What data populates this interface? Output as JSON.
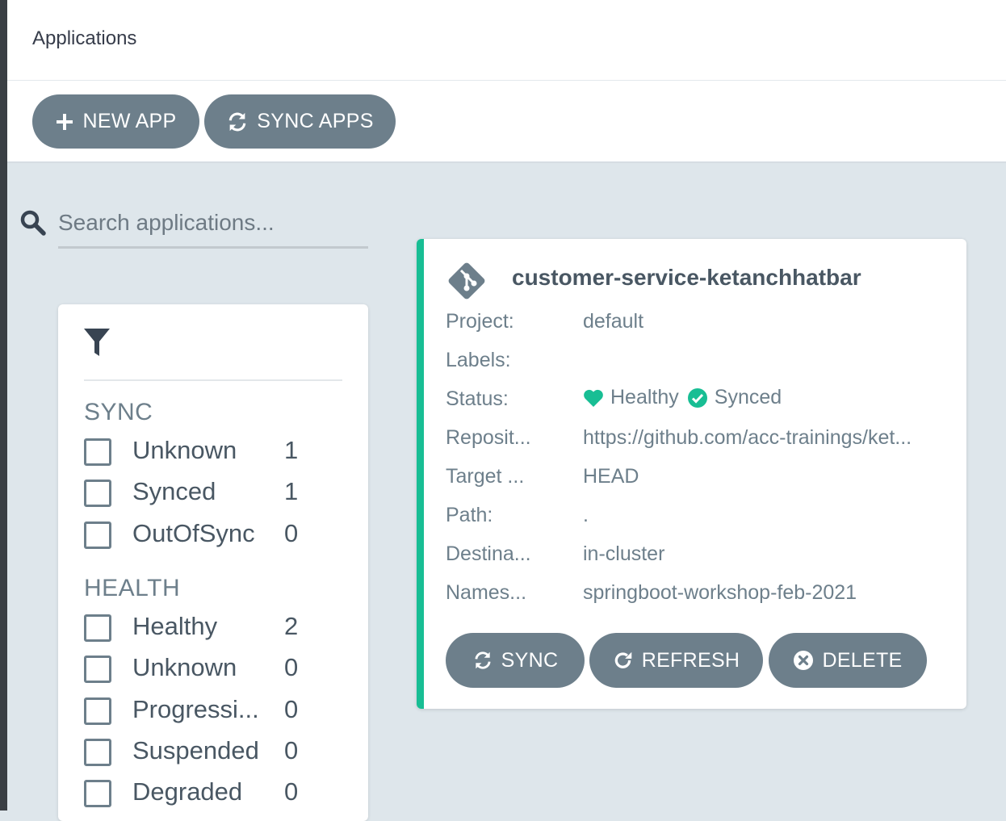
{
  "header": {
    "title": "Applications"
  },
  "toolbar": {
    "new_app_label": "NEW APP",
    "sync_apps_label": "SYNC APPS"
  },
  "search": {
    "placeholder": "Search applications..."
  },
  "filters": {
    "sync_title": "SYNC",
    "sync_items": [
      {
        "label": "Unknown",
        "count": "1"
      },
      {
        "label": "Synced",
        "count": "1"
      },
      {
        "label": "OutOfSync",
        "count": "0"
      }
    ],
    "health_title": "HEALTH",
    "health_items": [
      {
        "label": "Healthy",
        "count": "2"
      },
      {
        "label": "Unknown",
        "count": "0"
      },
      {
        "label": "Progressi...",
        "count": "0"
      },
      {
        "label": "Suspended",
        "count": "0"
      },
      {
        "label": "Degraded",
        "count": "0"
      }
    ]
  },
  "app": {
    "name": "customer-service-ketanchhatbar",
    "fields": [
      {
        "label": "Project:",
        "value": "default"
      },
      {
        "label": "Labels:",
        "value": ""
      },
      {
        "label": "Status:",
        "value": ""
      },
      {
        "label": "Reposit...",
        "value": "https://github.com/acc-trainings/ket..."
      },
      {
        "label": "Target ...",
        "value": "HEAD"
      },
      {
        "label": "Path:",
        "value": "."
      },
      {
        "label": "Destina...",
        "value": "in-cluster"
      },
      {
        "label": "Names...",
        "value": "springboot-workshop-feb-2021"
      }
    ],
    "health_status": "Healthy",
    "sync_status": "Synced",
    "buttons": {
      "sync": "SYNC",
      "refresh": "REFRESH",
      "delete": "DELETE"
    }
  },
  "colors": {
    "accent_green": "#18be94",
    "button_gray": "#6d7f8b",
    "background": "#dee6eb"
  },
  "icons": [
    "plus-icon",
    "sync-icon",
    "search-icon",
    "filter-icon",
    "git-icon",
    "heart-icon",
    "check-circle-icon",
    "refresh-icon",
    "delete-icon"
  ]
}
